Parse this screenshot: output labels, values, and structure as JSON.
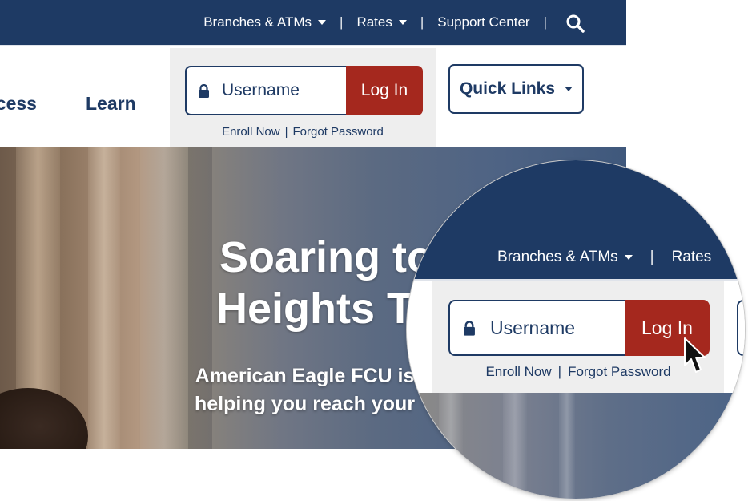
{
  "topbar": {
    "links": [
      {
        "label": "Branches & ATMs",
        "has_dropdown": true
      },
      {
        "label": "Rates",
        "has_dropdown": true
      },
      {
        "label": "Support Center",
        "has_dropdown": false
      }
    ],
    "separator": "|",
    "search_icon": "search-icon"
  },
  "nav": {
    "access": "ccess",
    "learn": "Learn"
  },
  "login": {
    "username_placeholder": "Username",
    "login_label": "Log In",
    "enroll": "Enroll Now",
    "forgot": "Forgot Password",
    "separator": "|",
    "lock_icon": "lock-icon"
  },
  "quick_links": {
    "label": "Quick Links"
  },
  "hero": {
    "title_line1": "Soaring to",
    "title_line2": "Heights To",
    "subtitle_line1": "American Eagle FCU is",
    "subtitle_line2": "helping you reach your"
  },
  "zoom": {
    "nav_branches": "Branches & ATMs",
    "nav_rates": "Rates",
    "separator": "|",
    "username_placeholder": "Username",
    "login_label": "Log In",
    "enroll": "Enroll Now",
    "forgot": "Forgot Password"
  },
  "colors": {
    "navy": "#1e3a64",
    "login_red": "#a5281e",
    "panel_gray": "#eeeeee"
  }
}
